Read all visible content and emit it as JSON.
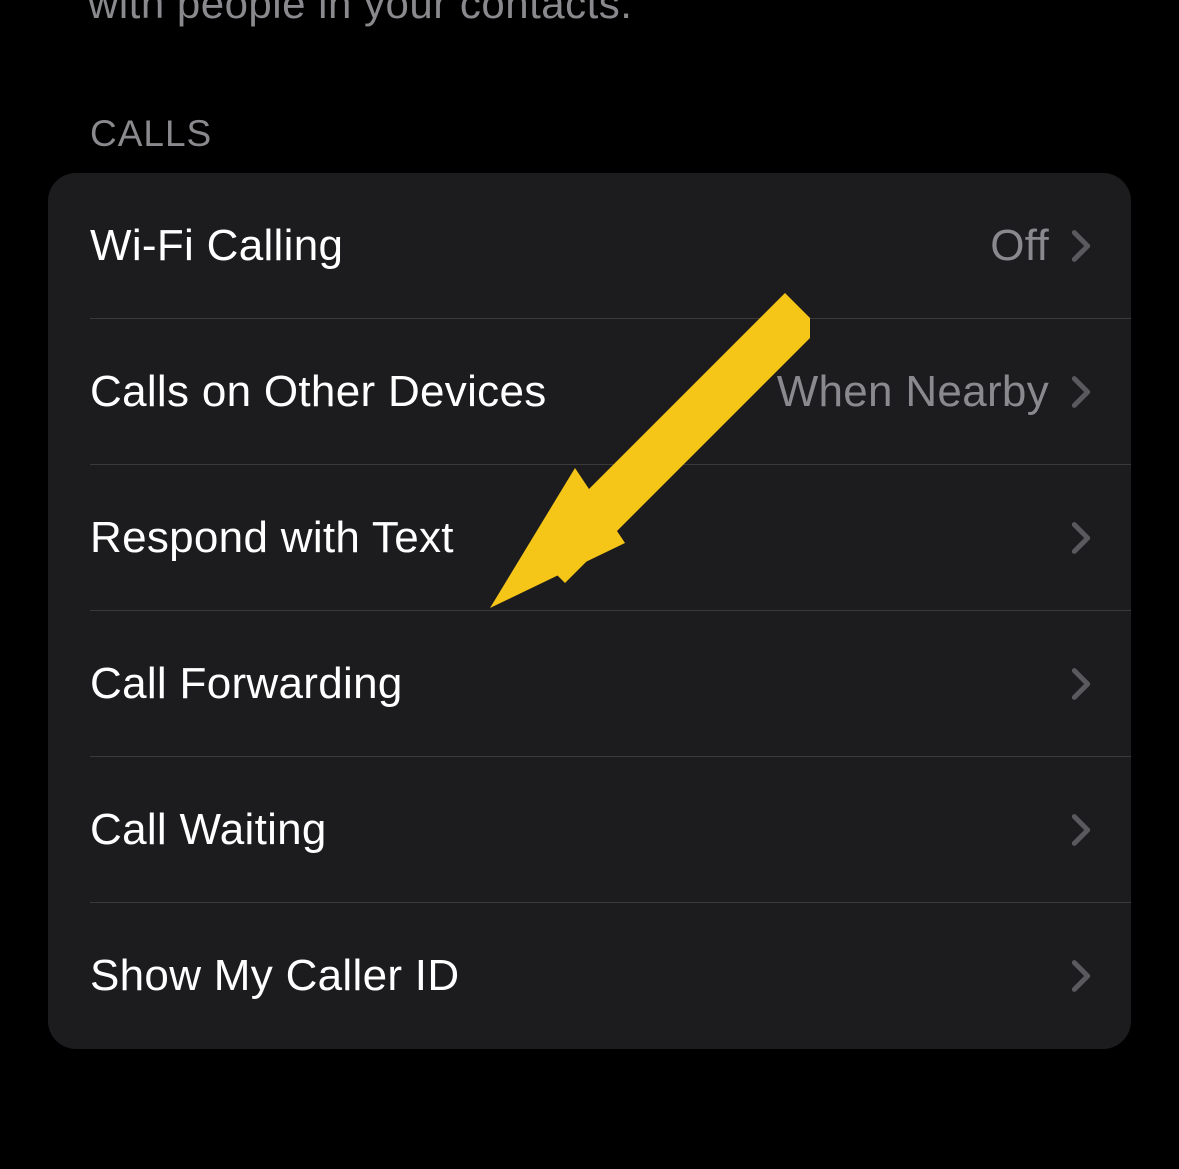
{
  "header": {
    "truncated_description": "with people in your contacts.",
    "section_title": "CALLS"
  },
  "rows": [
    {
      "label": "Wi-Fi Calling",
      "value": "Off"
    },
    {
      "label": "Calls on Other Devices",
      "value": "When Nearby"
    },
    {
      "label": "Respond with Text",
      "value": ""
    },
    {
      "label": "Call Forwarding",
      "value": ""
    },
    {
      "label": "Call Waiting",
      "value": ""
    },
    {
      "label": "Show My Caller ID",
      "value": ""
    }
  ],
  "annotation": {
    "arrow_color": "#f5c518"
  }
}
